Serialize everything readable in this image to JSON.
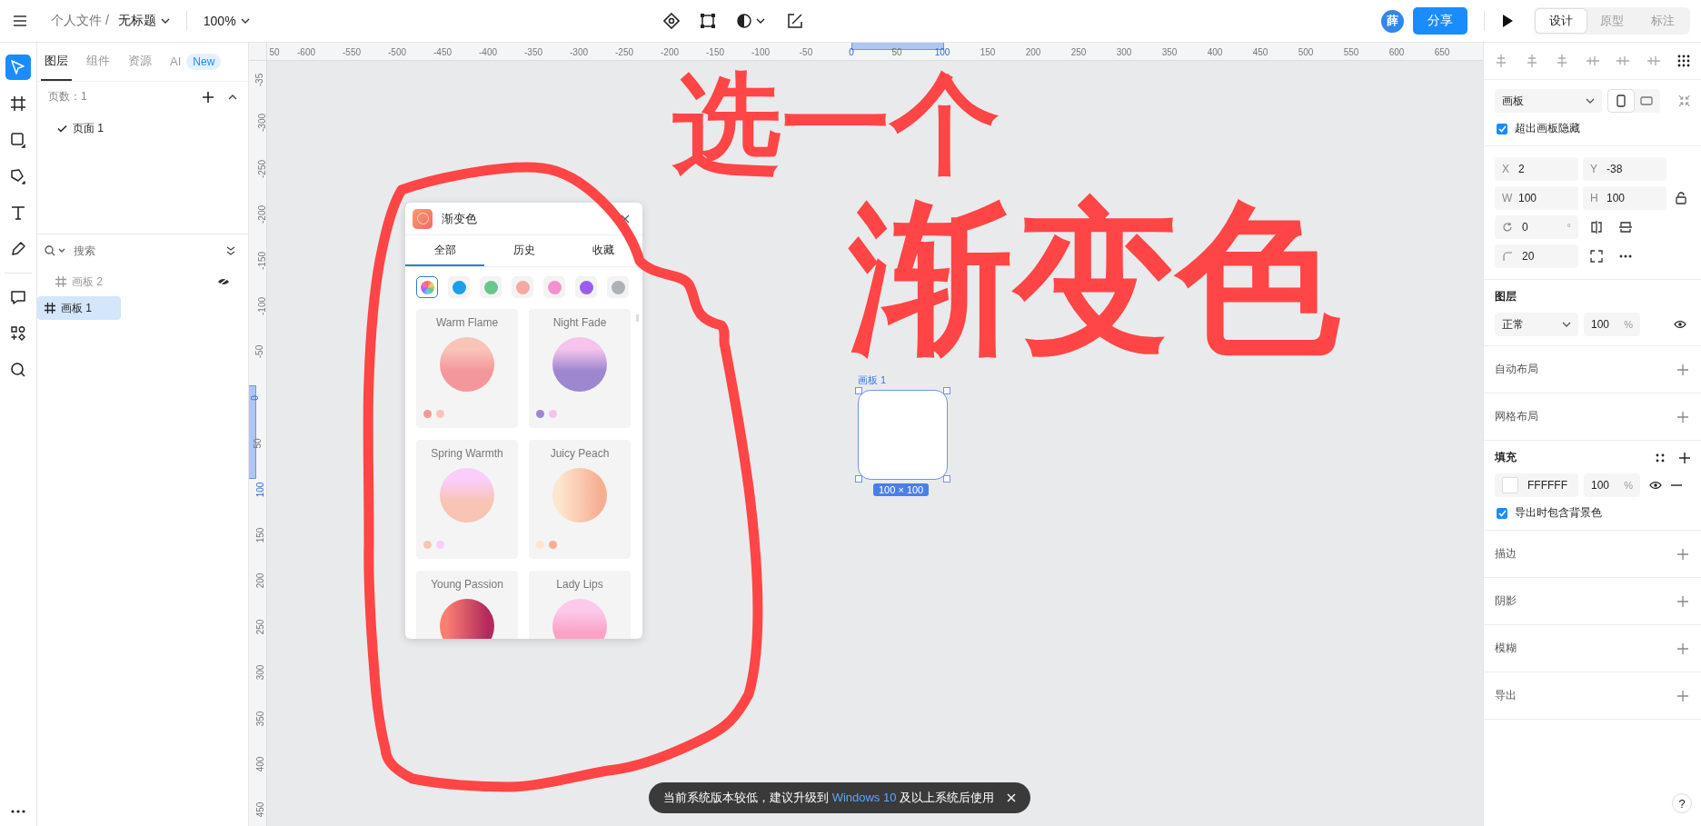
{
  "toolbar": {
    "file_path": "个人文件 /",
    "file_name": "无标题",
    "zoom": "100%",
    "avatar": "薛",
    "share": "分享",
    "modes": [
      {
        "label": "设计",
        "selected": true
      },
      {
        "label": "原型",
        "selected": false
      },
      {
        "label": "标注",
        "selected": false
      }
    ]
  },
  "tools": [
    {
      "kind": "pointer",
      "selected": true
    },
    {
      "kind": "frame",
      "selected": false
    },
    {
      "kind": "rect",
      "selected": false
    },
    {
      "kind": "pen",
      "selected": false
    },
    {
      "kind": "text",
      "selected": false
    },
    {
      "kind": "pencil",
      "selected": false
    },
    {
      "kind": "comment",
      "selected": false
    },
    {
      "kind": "components",
      "selected": false
    },
    {
      "kind": "search",
      "selected": false
    }
  ],
  "layers_panel": {
    "tabs": [
      {
        "label": "图层",
        "selected": true
      },
      {
        "label": "组件",
        "selected": false
      },
      {
        "label": "资源",
        "selected": false
      },
      {
        "label": "AI",
        "selected": false,
        "badge": "New"
      }
    ],
    "page_count": "页数：1",
    "pages": [
      {
        "name": "页面 1",
        "selected": true
      }
    ],
    "search_placeholder": "搜索",
    "layers": [
      {
        "name": "画板 2",
        "hidden": true,
        "selected": false
      },
      {
        "name": "画板 1",
        "hidden": false,
        "selected": true
      }
    ]
  },
  "rulers": {
    "top": [
      {
        "label": "50",
        "selected": false
      },
      {
        "label": "-600",
        "selected": false
      },
      {
        "label": "-550",
        "selected": false
      },
      {
        "label": "-500",
        "selected": false
      },
      {
        "label": "-450",
        "selected": false
      },
      {
        "label": "-400",
        "selected": false
      },
      {
        "label": "-350",
        "selected": false
      },
      {
        "label": "-300",
        "selected": false
      },
      {
        "label": "-250",
        "selected": false
      },
      {
        "label": "-200",
        "selected": false
      },
      {
        "label": "-150",
        "selected": false
      },
      {
        "label": "-100",
        "selected": false
      },
      {
        "label": "-50",
        "selected": false
      },
      {
        "label": "0",
        "selected": true
      },
      {
        "label": "50",
        "selected": false
      },
      {
        "label": "100",
        "selected": true
      },
      {
        "label": "150",
        "selected": false
      },
      {
        "label": "200",
        "selected": false
      },
      {
        "label": "250",
        "selected": false
      },
      {
        "label": "300",
        "selected": false
      },
      {
        "label": "350",
        "selected": false
      },
      {
        "label": "400",
        "selected": false
      },
      {
        "label": "450",
        "selected": false
      },
      {
        "label": "500",
        "selected": false
      },
      {
        "label": "550",
        "selected": false
      },
      {
        "label": "600",
        "selected": false
      },
      {
        "label": "650",
        "selected": false
      }
    ],
    "left": [
      {
        "label": "-35",
        "selected": false
      },
      {
        "label": "-300",
        "selected": false
      },
      {
        "label": "-250",
        "selected": false
      },
      {
        "label": "-200",
        "selected": false
      },
      {
        "label": "-150",
        "selected": false
      },
      {
        "label": "-100",
        "selected": false
      },
      {
        "label": "-50",
        "selected": false
      },
      {
        "label": "0",
        "selected": true
      },
      {
        "label": "50",
        "selected": false
      },
      {
        "label": "100",
        "selected": true
      },
      {
        "label": "150",
        "selected": false
      },
      {
        "label": "200",
        "selected": false
      },
      {
        "label": "250",
        "selected": false
      },
      {
        "label": "300",
        "selected": false
      },
      {
        "label": "350",
        "selected": false
      },
      {
        "label": "400",
        "selected": false
      },
      {
        "label": "450",
        "selected": false
      }
    ]
  },
  "gradient_plugin": {
    "title": "渐变色",
    "tabs": [
      {
        "label": "全部",
        "selected": true
      },
      {
        "label": "历史",
        "selected": false
      },
      {
        "label": "收藏",
        "selected": false
      }
    ],
    "filters": [
      {
        "kind": "all",
        "selected": true
      },
      {
        "kind": "hue",
        "color": "#1a9fe8",
        "selected": false
      },
      {
        "kind": "hue",
        "color": "#6cc48f",
        "selected": false
      },
      {
        "kind": "hue",
        "color": "#f4a9a4",
        "selected": false
      },
      {
        "kind": "hue",
        "color": "#f88fcf",
        "selected": false
      },
      {
        "kind": "hue",
        "color": "#9b5cf0",
        "selected": false
      },
      {
        "kind": "hue",
        "color": "#aeb1b5",
        "selected": false
      }
    ],
    "gradients": [
      {
        "name": "Warm Flame",
        "kind": "vertical",
        "stops": [
          {
            "color": "#f4979c"
          },
          {
            "color": "#f9c4b8"
          }
        ]
      },
      {
        "name": "Night Fade",
        "kind": "vertical",
        "stops": [
          {
            "color": "#9d87cf"
          },
          {
            "color": "#f6c3ec"
          }
        ]
      },
      {
        "name": "Spring Warmth",
        "kind": "vertical",
        "stops": [
          {
            "color": "#f8c4b4"
          },
          {
            "color": "#fbcdfb"
          }
        ]
      },
      {
        "name": "Juicy Peach",
        "kind": "horizontal",
        "stops": [
          {
            "color": "#fde6cf"
          },
          {
            "color": "#f7ae92"
          }
        ]
      },
      {
        "name": "Young Passion",
        "kind": "horizontal",
        "stops": [
          {
            "color": "#fa7f72"
          },
          {
            "color": "#b12a5b"
          }
        ]
      },
      {
        "name": "Lady Lips",
        "kind": "vertical",
        "stops": [
          {
            "color": "#fba2c6"
          },
          {
            "color": "#fcc9ea"
          }
        ]
      }
    ]
  },
  "board": {
    "label": "画板 1",
    "size": "100 × 100"
  },
  "toast": {
    "before": "当前系统版本较低，建议升级到 ",
    "link": "Windows 10",
    "after": " 及以上系统后使用"
  },
  "annotation": {
    "lines": [
      "选一个",
      "渐变色"
    ]
  },
  "inspector": {
    "frame_type": "画板",
    "orientations": [
      {
        "kind": "portrait",
        "selected": true
      },
      {
        "kind": "landscape",
        "selected": false
      }
    ],
    "clip_content": {
      "label": "超出画板隐藏",
      "checked": true
    },
    "geometry": [
      {
        "kind": "text",
        "label": "X",
        "value": "2"
      },
      {
        "kind": "text",
        "label": "Y",
        "value": "-38"
      },
      {
        "kind": "text",
        "label": "W",
        "value": "100"
      },
      {
        "kind": "text",
        "label": "H",
        "value": "100"
      },
      {
        "kind": "rotate",
        "value": "0",
        "unit": "°"
      },
      {
        "kind": "radius",
        "value": "20"
      }
    ],
    "layer": {
      "title": "图层",
      "blend": "正常",
      "opacity": "100",
      "unit": "%"
    },
    "layout_sections": [
      "自动布局",
      "网格布局"
    ],
    "fill": {
      "title": "填充",
      "color": "#ffffff",
      "hex": "FFFFFF",
      "opacity": "100",
      "unit": "%",
      "export_bg": {
        "label": "导出时包含背景色",
        "checked": true
      }
    },
    "more_sections": [
      "描边",
      "阴影",
      "模糊",
      "导出"
    ]
  },
  "help": "?"
}
